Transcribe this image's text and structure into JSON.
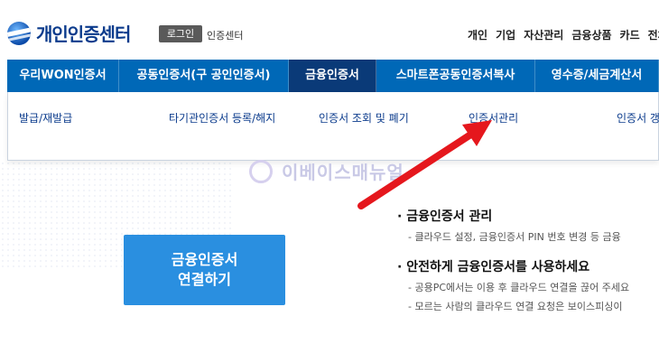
{
  "header": {
    "logo_text": "개인인증센터",
    "login_label": "로그인",
    "cert_center_label": "인증센터",
    "top_nav": [
      "개인",
      "기업",
      "자산관리",
      "금융상품",
      "카드",
      "전체"
    ]
  },
  "main_nav": {
    "tabs": [
      "우리WON인증서",
      "공동인증서(구 공인인증서)",
      "금융인증서",
      "스마트폰공동인증서복사",
      "영수증/세금계산서"
    ]
  },
  "sub_menu": {
    "items": [
      "발급/재발급",
      "타기관인증서 등록/해지",
      "인증서 조회 및 폐기",
      "인증서관리",
      "인증서 갱"
    ]
  },
  "watermark": "이베이스매뉴얼",
  "content": {
    "connect_button_line1": "금융인증서",
    "connect_button_line2": "연결하기",
    "section1_title": "· 금융인증서 관리",
    "section1_desc": "- 클라우드 설정, 금융인증서 PIN 번호 변경 등 금융",
    "section2_title": "· 안전하게 금융인증서를 사용하세요",
    "section2_desc1": "- 공용PC에서는 이용 후 클라우드 연결을 끊어 주세요",
    "section2_desc2": "- 모르는 사람의 클라우드 연결 요청은 보이스피싱이"
  },
  "colors": {
    "nav_bg": "#0068b7",
    "nav_active": "#0a3a78",
    "button_bg": "#2a8fe0",
    "arrow": "#e5171d"
  }
}
